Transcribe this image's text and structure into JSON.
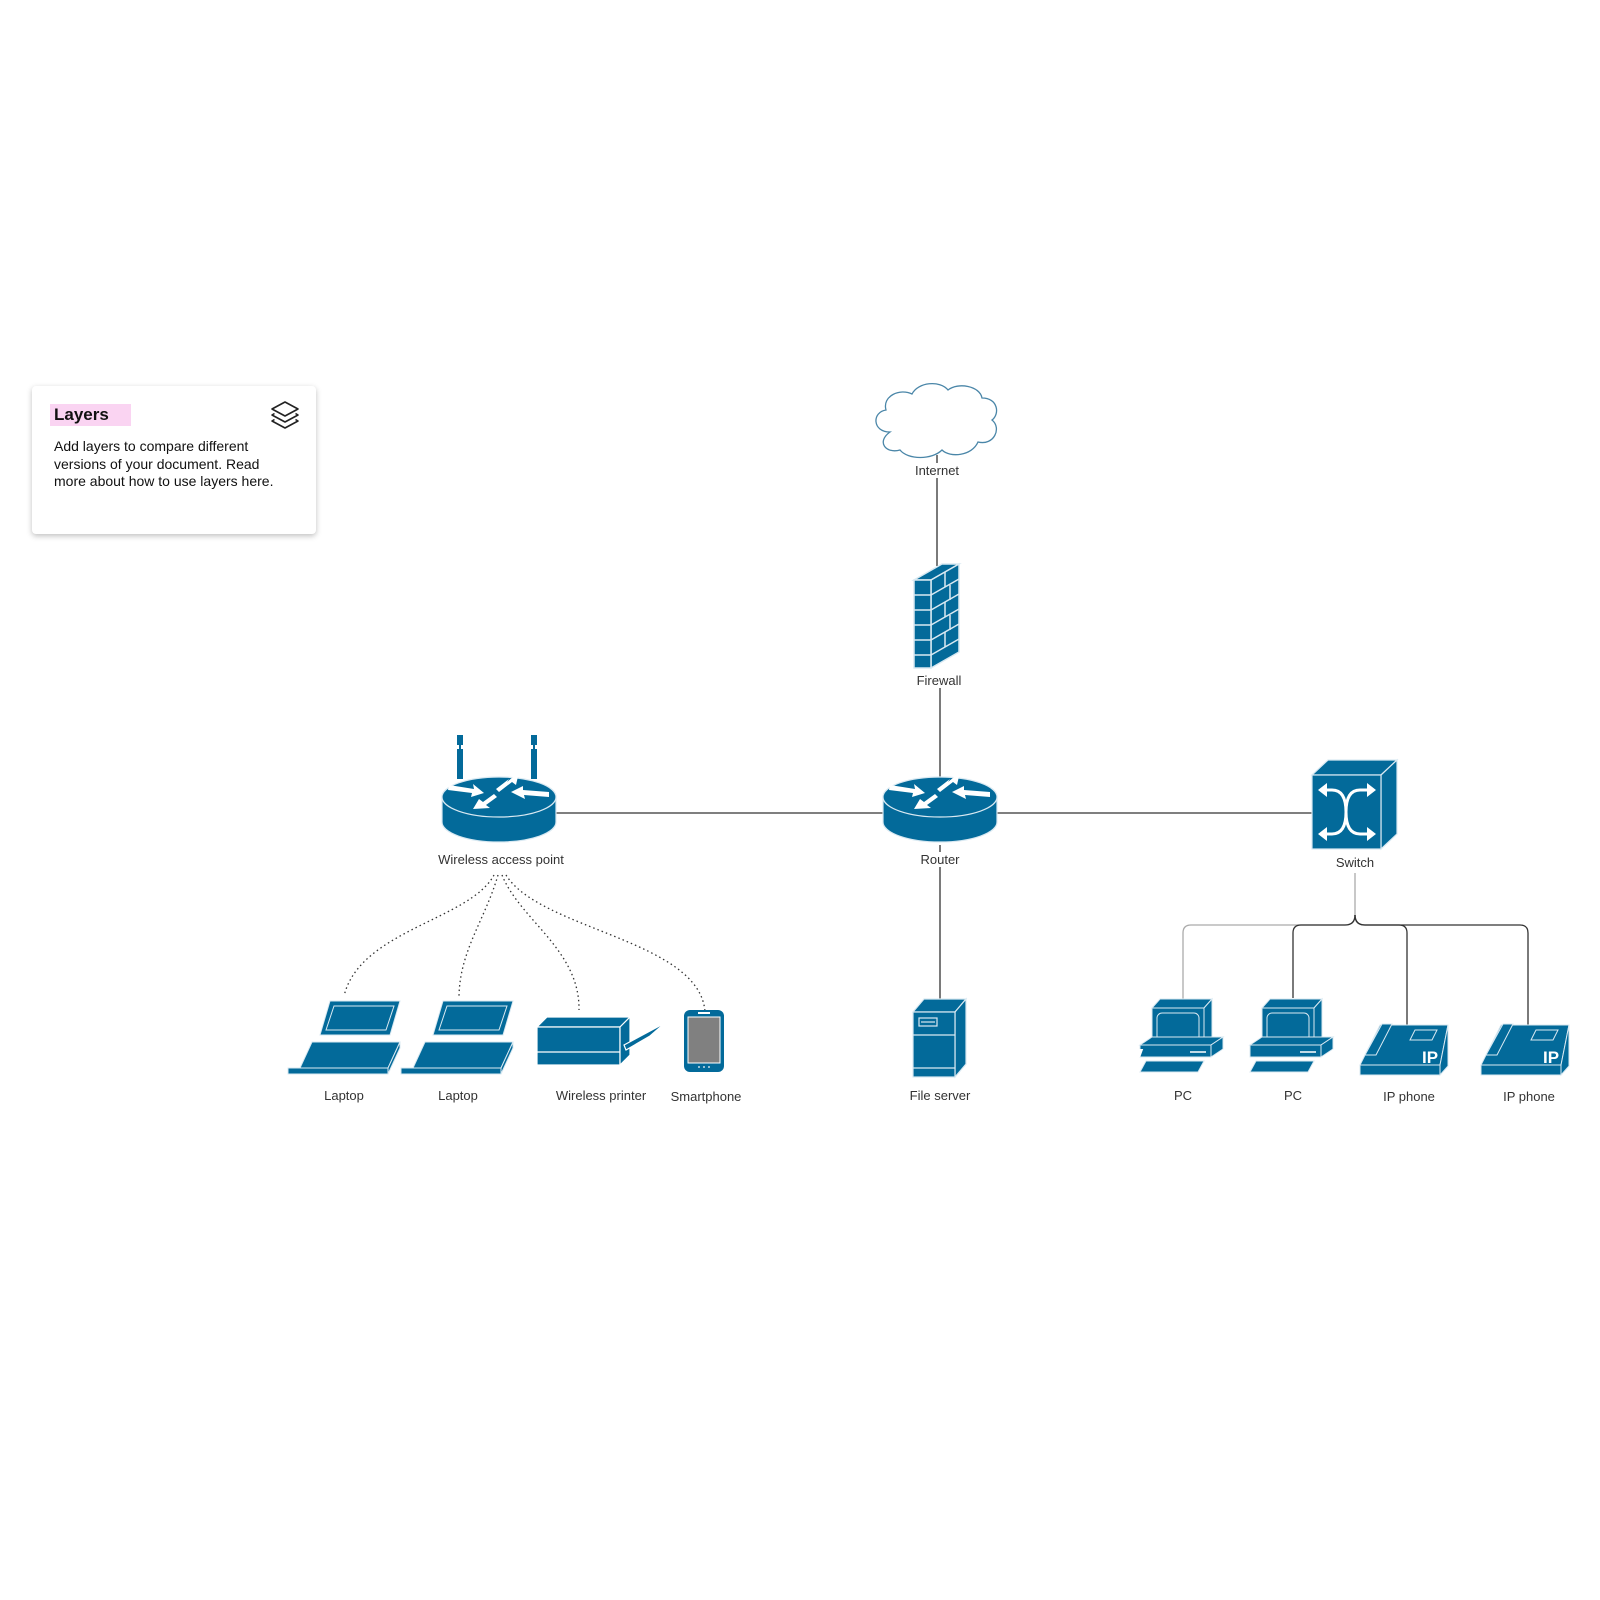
{
  "layers_panel": {
    "title": "Layers",
    "description": "Add layers to compare different versions of your document. Read more about how to use layers here.",
    "icon": "layers-icon",
    "highlight_color": "#fad4f2"
  },
  "colors": {
    "device_fill": "#036a9a",
    "device_edge": "#d9e9f2",
    "line": "#333333",
    "cloud_stroke": "#4a86a8",
    "screen_gray": "#808080"
  },
  "nodes": {
    "internet": {
      "label": "Internet",
      "type": "cloud"
    },
    "firewall": {
      "label": "Firewall",
      "type": "firewall"
    },
    "router": {
      "label": "Router",
      "type": "router"
    },
    "wap": {
      "label": "Wireless access point",
      "type": "wireless-router"
    },
    "switch": {
      "label": "Switch",
      "type": "switch"
    },
    "laptop1": {
      "label": "Laptop",
      "type": "laptop"
    },
    "laptop2": {
      "label": "Laptop",
      "type": "laptop"
    },
    "printer": {
      "label": "Wireless printer",
      "type": "printer"
    },
    "smartphone": {
      "label": "Smartphone",
      "type": "smartphone"
    },
    "fileserver": {
      "label": "File server",
      "type": "server"
    },
    "pc1": {
      "label": "PC",
      "type": "pc"
    },
    "pc2": {
      "label": "PC",
      "type": "pc"
    },
    "ipphone1": {
      "label": "IP phone",
      "type": "ip-phone"
    },
    "ipphone2": {
      "label": "IP phone",
      "type": "ip-phone"
    }
  },
  "ip_text": "IP",
  "connections": [
    {
      "from": "internet",
      "to": "firewall",
      "style": "solid"
    },
    {
      "from": "firewall",
      "to": "router",
      "style": "solid"
    },
    {
      "from": "router",
      "to": "wap",
      "style": "solid"
    },
    {
      "from": "router",
      "to": "switch",
      "style": "solid"
    },
    {
      "from": "router",
      "to": "fileserver",
      "style": "solid"
    },
    {
      "from": "wap",
      "to": "laptop1",
      "style": "dotted"
    },
    {
      "from": "wap",
      "to": "laptop2",
      "style": "dotted"
    },
    {
      "from": "wap",
      "to": "printer",
      "style": "dotted"
    },
    {
      "from": "wap",
      "to": "smartphone",
      "style": "dotted"
    },
    {
      "from": "switch",
      "to": "pc1",
      "style": "solid"
    },
    {
      "from": "switch",
      "to": "pc2",
      "style": "solid"
    },
    {
      "from": "switch",
      "to": "ipphone1",
      "style": "solid"
    },
    {
      "from": "switch",
      "to": "ipphone2",
      "style": "solid"
    }
  ]
}
